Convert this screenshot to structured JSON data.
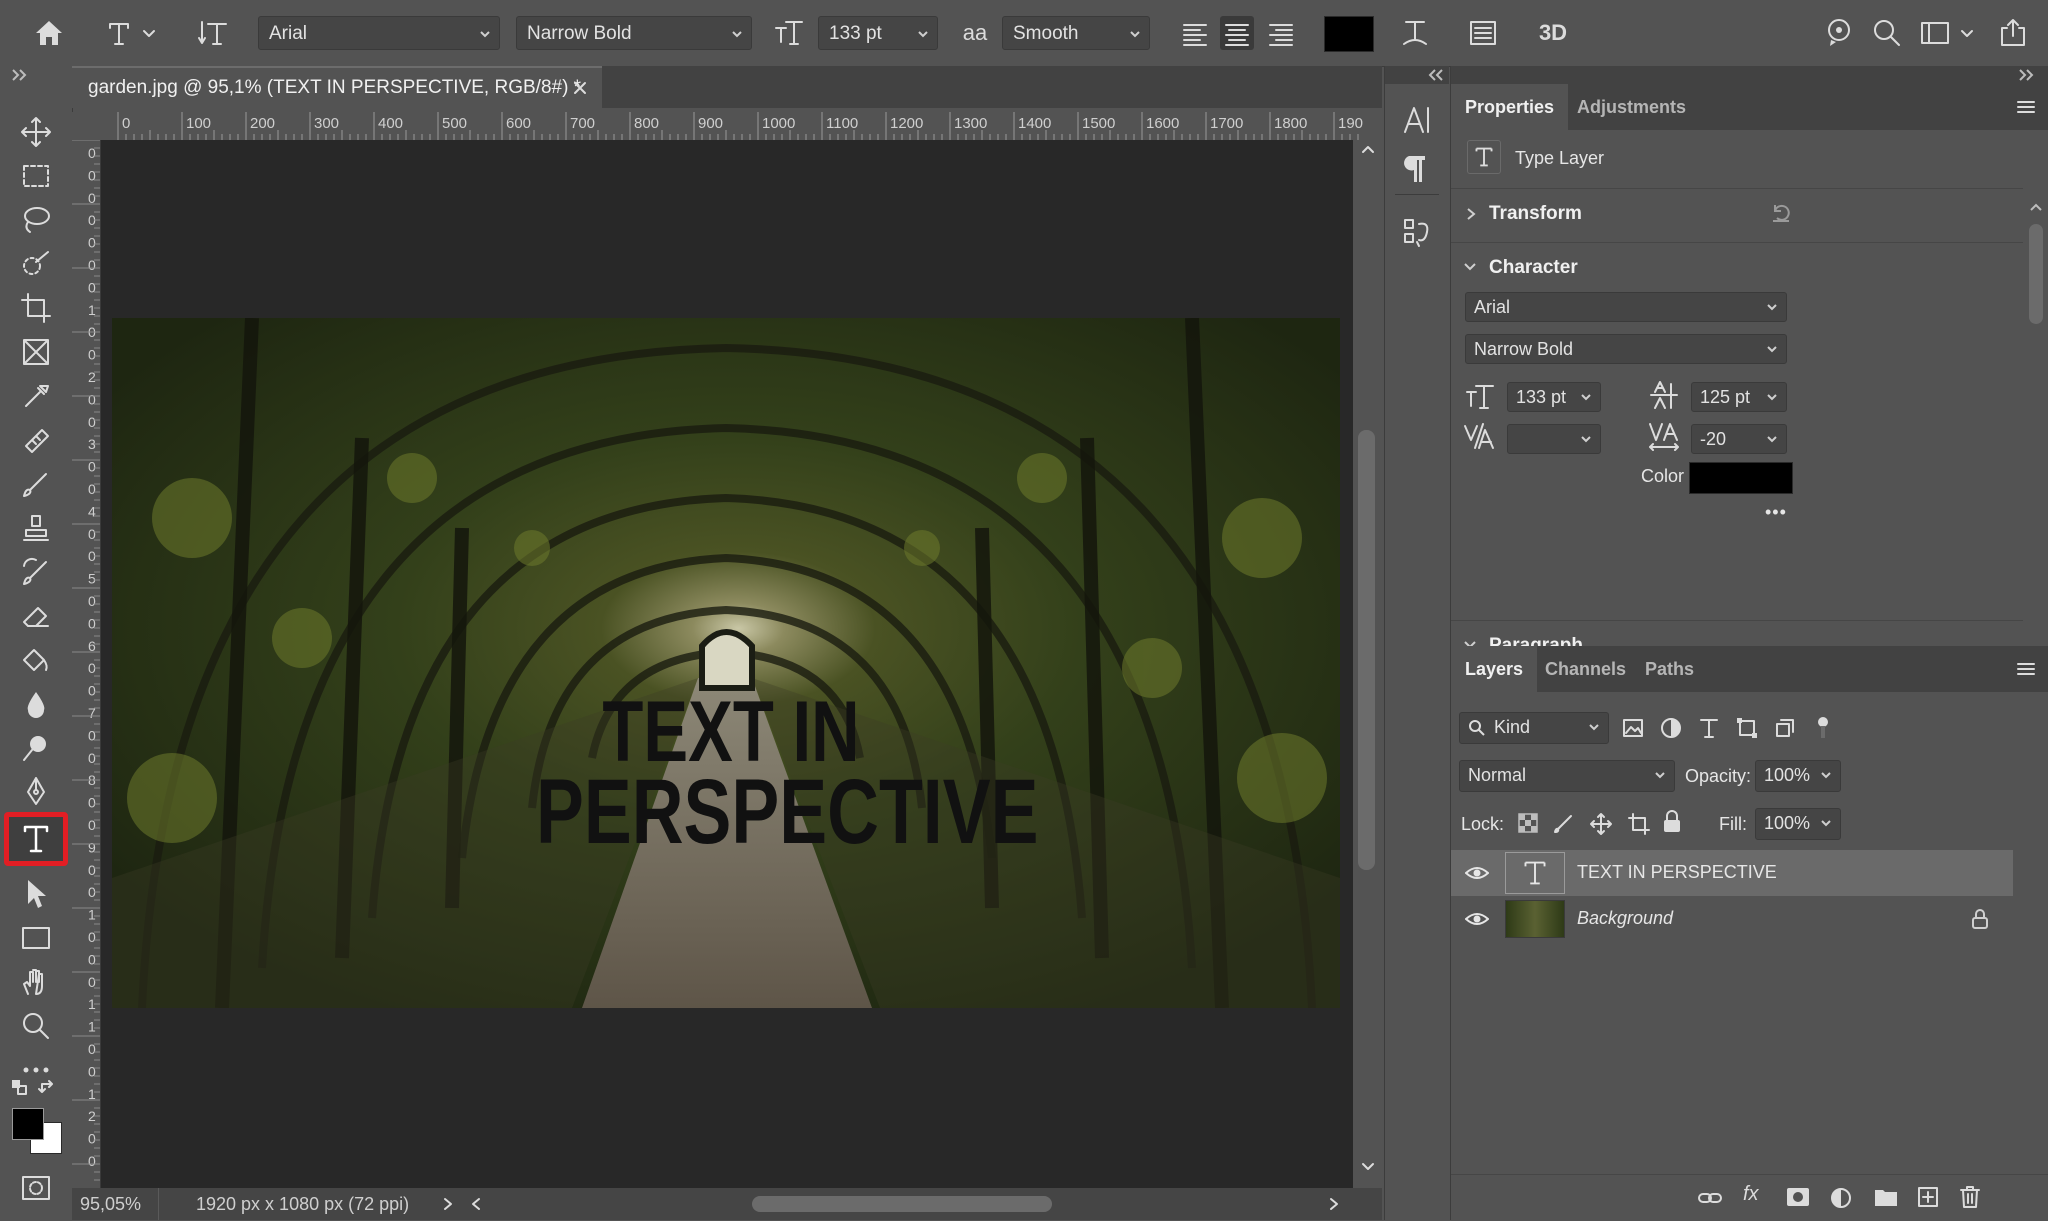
{
  "options_bar": {
    "font_family": "Arial",
    "font_style": "Narrow Bold",
    "font_size": "133 pt",
    "antialias_icon": "aa",
    "antialias": "Smooth",
    "threed_label": "3D",
    "text_color": "#000000"
  },
  "document": {
    "tab_title": "garden.jpg @ 95,1% (TEXT IN PERSPECTIVE, RGB/8#) *",
    "ruler_top": [
      "0",
      "100",
      "200",
      "300",
      "400",
      "500",
      "600",
      "700",
      "800",
      "900",
      "1000",
      "1100",
      "1200",
      "1300",
      "1400",
      "1500",
      "1600",
      "1700",
      "1800",
      "190"
    ],
    "ruler_left": [
      "0",
      "0",
      "0",
      "0",
      "0",
      "0",
      "0",
      "1",
      "0",
      "0",
      "2",
      "0",
      "0",
      "3",
      "0",
      "0",
      "4",
      "0",
      "0",
      "5",
      "0",
      "0",
      "6",
      "0",
      "0",
      "7",
      "0",
      "0",
      "8",
      "0",
      "0",
      "9",
      "0",
      "0",
      "1",
      "0",
      "0",
      "0",
      "1",
      "1",
      "0",
      "0",
      "1",
      "2",
      "0",
      "0"
    ],
    "canvas_text_line1": "TEXT IN",
    "canvas_text_line2": "PERSPECTIVE"
  },
  "status_bar": {
    "zoom": "95,05%",
    "doc_info": "1920 px x 1080 px (72 ppi)"
  },
  "properties": {
    "tabs": [
      "Properties",
      "Adjustments"
    ],
    "layer_type": "Type Layer",
    "transform_label": "Transform",
    "character_label": "Character",
    "font_family": "Arial",
    "font_style": "Narrow Bold",
    "font_size": "133 pt",
    "leading": "125 pt",
    "kerning": "",
    "tracking": "-20",
    "color_label": "Color",
    "color_value": "#000000",
    "more": "•••",
    "paragraph_label": "Paragraph"
  },
  "layers": {
    "tabs": [
      "Layers",
      "Channels",
      "Paths"
    ],
    "filter_kind": "Kind",
    "blend_mode": "Normal",
    "opacity_label": "Opacity:",
    "opacity": "100%",
    "lock_label": "Lock:",
    "fill_label": "Fill:",
    "fill": "100%",
    "items": [
      {
        "name": "TEXT IN PERSPECTIVE",
        "kind": "type",
        "selected": true
      },
      {
        "name": "Background",
        "kind": "image",
        "locked": true
      }
    ]
  },
  "colors": {
    "ui_bg": "#535353",
    "ui_dark": "#424242",
    "canvas_bg": "#282828",
    "highlight": "#e21e24",
    "foreground_swatch": "#000000",
    "background_swatch": "#ffffff"
  }
}
